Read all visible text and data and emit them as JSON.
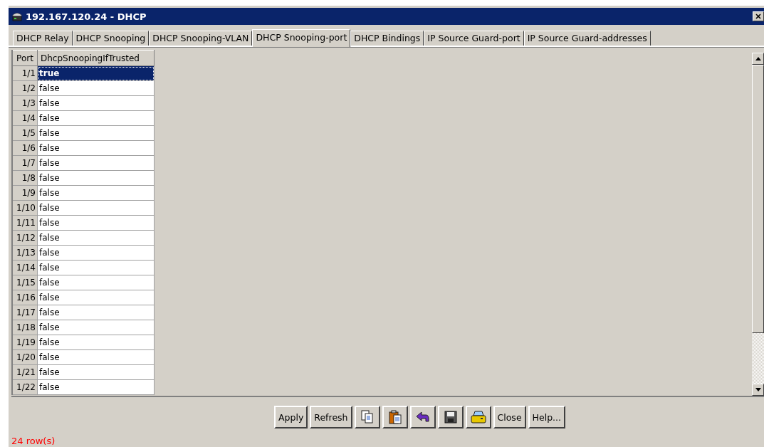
{
  "window": {
    "title": "192.167.120.24 - DHCP"
  },
  "tabs": [
    {
      "label": "DHCP Relay",
      "selected": false
    },
    {
      "label": "DHCP Snooping",
      "selected": false
    },
    {
      "label": "DHCP Snooping-VLAN",
      "selected": false
    },
    {
      "label": "DHCP Snooping-port",
      "selected": true
    },
    {
      "label": "DHCP Bindings",
      "selected": false
    },
    {
      "label": "IP Source Guard-port",
      "selected": false
    },
    {
      "label": "IP Source Guard-addresses",
      "selected": false
    }
  ],
  "table": {
    "columns": [
      "Port",
      "DhcpSnoopingIfTrusted"
    ],
    "rows": [
      {
        "port": "1/1",
        "value": "true",
        "selected": true
      },
      {
        "port": "1/2",
        "value": "false",
        "selected": false
      },
      {
        "port": "1/3",
        "value": "false",
        "selected": false
      },
      {
        "port": "1/4",
        "value": "false",
        "selected": false
      },
      {
        "port": "1/5",
        "value": "false",
        "selected": false
      },
      {
        "port": "1/6",
        "value": "false",
        "selected": false
      },
      {
        "port": "1/7",
        "value": "false",
        "selected": false
      },
      {
        "port": "1/8",
        "value": "false",
        "selected": false
      },
      {
        "port": "1/9",
        "value": "false",
        "selected": false
      },
      {
        "port": "1/10",
        "value": "false",
        "selected": false
      },
      {
        "port": "1/11",
        "value": "false",
        "selected": false
      },
      {
        "port": "1/12",
        "value": "false",
        "selected": false
      },
      {
        "port": "1/13",
        "value": "false",
        "selected": false
      },
      {
        "port": "1/14",
        "value": "false",
        "selected": false
      },
      {
        "port": "1/15",
        "value": "false",
        "selected": false
      },
      {
        "port": "1/16",
        "value": "false",
        "selected": false
      },
      {
        "port": "1/17",
        "value": "false",
        "selected": false
      },
      {
        "port": "1/18",
        "value": "false",
        "selected": false
      },
      {
        "port": "1/19",
        "value": "false",
        "selected": false
      },
      {
        "port": "1/20",
        "value": "false",
        "selected": false
      },
      {
        "port": "1/21",
        "value": "false",
        "selected": false
      },
      {
        "port": "1/22",
        "value": "false",
        "selected": false
      }
    ]
  },
  "buttons": [
    {
      "kind": "text",
      "label": "Apply"
    },
    {
      "kind": "text",
      "label": "Refresh"
    },
    {
      "kind": "copy"
    },
    {
      "kind": "paste"
    },
    {
      "kind": "undo"
    },
    {
      "kind": "save"
    },
    {
      "kind": "print"
    },
    {
      "kind": "text",
      "label": "Close"
    },
    {
      "kind": "text",
      "label": "Help..."
    }
  ],
  "status_bar": "24 row(s)"
}
